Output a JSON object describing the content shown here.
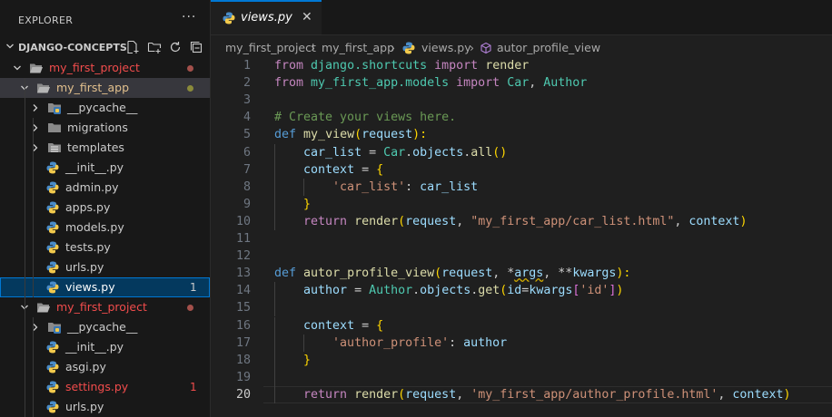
{
  "explorer": {
    "title": "EXPLORER",
    "more_label": "···",
    "workspace": "DJANGO-CONCEPTS",
    "actions": [
      "new-file-icon",
      "new-folder-icon",
      "refresh-icon",
      "collapse-all-icon"
    ]
  },
  "tree": [
    {
      "label": "my_first_project",
      "kind": "folder-open",
      "color": "#f14c4c",
      "decoration": "dot",
      "dot_color": "#a3504b"
    },
    {
      "label": "my_first_app",
      "kind": "folder-open",
      "color": "#e2c08d",
      "decoration": "dot",
      "dot_color": "#8a8a3a"
    },
    {
      "label": "__pycache__",
      "kind": "folder-py",
      "color": "#cccccc"
    },
    {
      "label": "migrations",
      "kind": "folder",
      "color": "#cccccc"
    },
    {
      "label": "templates",
      "kind": "folder-tpl",
      "color": "#cccccc"
    },
    {
      "label": "__init__.py",
      "kind": "py",
      "color": "#cccccc"
    },
    {
      "label": "admin.py",
      "kind": "py",
      "color": "#cccccc"
    },
    {
      "label": "apps.py",
      "kind": "py",
      "color": "#cccccc"
    },
    {
      "label": "models.py",
      "kind": "py",
      "color": "#cccccc"
    },
    {
      "label": "tests.py",
      "kind": "py",
      "color": "#cccccc"
    },
    {
      "label": "urls.py",
      "kind": "py",
      "color": "#cccccc"
    },
    {
      "label": "views.py",
      "kind": "py",
      "color": "#ffffff",
      "badge": "1",
      "badge_color": "#cccccc"
    },
    {
      "label": "my_first_project",
      "kind": "folder-open",
      "color": "#f14c4c",
      "decoration": "dot",
      "dot_color": "#a3504b"
    },
    {
      "label": "__pycache__",
      "kind": "folder-py",
      "color": "#cccccc"
    },
    {
      "label": "__init__.py",
      "kind": "py",
      "color": "#cccccc"
    },
    {
      "label": "asgi.py",
      "kind": "py",
      "color": "#cccccc"
    },
    {
      "label": "settings.py",
      "kind": "py",
      "color": "#f14c4c",
      "badge": "1",
      "badge_color": "#f14c4c"
    },
    {
      "label": "urls.py",
      "kind": "py",
      "color": "#cccccc"
    }
  ],
  "tab": {
    "label": "views.py",
    "close": "✕"
  },
  "breadcrumb": [
    "my_first_project",
    "my_first_app",
    "views.py",
    "autor_profile_view"
  ],
  "editor": {
    "current_line": 20
  },
  "code": [
    [
      [
        "from",
        "k"
      ],
      [
        " django.shortcuts ",
        "c"
      ],
      [
        "import",
        "k"
      ],
      [
        " ",
        "p"
      ],
      [
        "render",
        "f"
      ]
    ],
    [
      [
        "from",
        "k"
      ],
      [
        " my_first_app.models ",
        "c"
      ],
      [
        "import",
        "k"
      ],
      [
        " ",
        "p"
      ],
      [
        "Car",
        "c"
      ],
      [
        ", ",
        "p"
      ],
      [
        "Author",
        "c"
      ]
    ],
    [],
    [
      [
        "# Create your views here.",
        "cm"
      ]
    ],
    [
      [
        "def",
        "kb"
      ],
      [
        " ",
        "p"
      ],
      [
        "my_view",
        "f"
      ],
      [
        "(",
        "b1"
      ],
      [
        "request",
        "v"
      ],
      [
        "):",
        "b1"
      ]
    ],
    [
      [
        "    ",
        "p"
      ],
      [
        "car_list",
        "v"
      ],
      [
        " = ",
        "p"
      ],
      [
        "Car",
        "c"
      ],
      [
        ".",
        "p"
      ],
      [
        "objects",
        "v"
      ],
      [
        ".",
        "p"
      ],
      [
        "all",
        "f"
      ],
      [
        "()",
        "b1"
      ]
    ],
    [
      [
        "    ",
        "p"
      ],
      [
        "context",
        "v"
      ],
      [
        " = ",
        "p"
      ],
      [
        "{",
        "b1"
      ]
    ],
    [
      [
        "        ",
        "p"
      ],
      [
        "'car_list'",
        "s"
      ],
      [
        ": ",
        "p"
      ],
      [
        "car_list",
        "v"
      ]
    ],
    [
      [
        "    ",
        "p"
      ],
      [
        "}",
        "b1"
      ]
    ],
    [
      [
        "    ",
        "p"
      ],
      [
        "return",
        "k"
      ],
      [
        " ",
        "p"
      ],
      [
        "render",
        "f"
      ],
      [
        "(",
        "b1"
      ],
      [
        "request",
        "v"
      ],
      [
        ", ",
        "p"
      ],
      [
        "\"my_first_app/car_list.html\"",
        "s"
      ],
      [
        ", ",
        "p"
      ],
      [
        "context",
        "v"
      ],
      [
        ")",
        "b1"
      ]
    ],
    [],
    [],
    [
      [
        "def",
        "kb"
      ],
      [
        " ",
        "p"
      ],
      [
        "autor_profile_view",
        "f"
      ],
      [
        "(",
        "b1"
      ],
      [
        "request",
        "v"
      ],
      [
        ", ",
        "p"
      ],
      [
        "*",
        "p"
      ],
      [
        "args",
        "v warn"
      ],
      [
        ", ",
        "p"
      ],
      [
        "**",
        "p"
      ],
      [
        "kwargs",
        "v"
      ],
      [
        "):",
        "b1"
      ]
    ],
    [
      [
        "    ",
        "p"
      ],
      [
        "author",
        "v"
      ],
      [
        " = ",
        "p"
      ],
      [
        "Author",
        "c"
      ],
      [
        ".",
        "p"
      ],
      [
        "objects",
        "v"
      ],
      [
        ".",
        "p"
      ],
      [
        "get",
        "f"
      ],
      [
        "(",
        "b1"
      ],
      [
        "id",
        "v"
      ],
      [
        "=",
        "p"
      ],
      [
        "kwargs",
        "v"
      ],
      [
        "[",
        "b2"
      ],
      [
        "'id'",
        "s"
      ],
      [
        "]",
        "b2"
      ],
      [
        ")",
        "b1"
      ]
    ],
    [],
    [
      [
        "    ",
        "p"
      ],
      [
        "context",
        "v"
      ],
      [
        " = ",
        "p"
      ],
      [
        "{",
        "b1"
      ]
    ],
    [
      [
        "        ",
        "p"
      ],
      [
        "'author_profile'",
        "s"
      ],
      [
        ": ",
        "p"
      ],
      [
        "author",
        "v"
      ]
    ],
    [
      [
        "    ",
        "p"
      ],
      [
        "}",
        "b1"
      ]
    ],
    [],
    [
      [
        "    ",
        "p"
      ],
      [
        "return",
        "k"
      ],
      [
        " ",
        "p"
      ],
      [
        "render",
        "f"
      ],
      [
        "(",
        "b1"
      ],
      [
        "request",
        "v"
      ],
      [
        ", ",
        "p"
      ],
      [
        "'my_first_app/author_profile.html'",
        "s"
      ],
      [
        ", ",
        "p"
      ],
      [
        "context",
        "v"
      ],
      [
        ")",
        "b1"
      ]
    ]
  ]
}
